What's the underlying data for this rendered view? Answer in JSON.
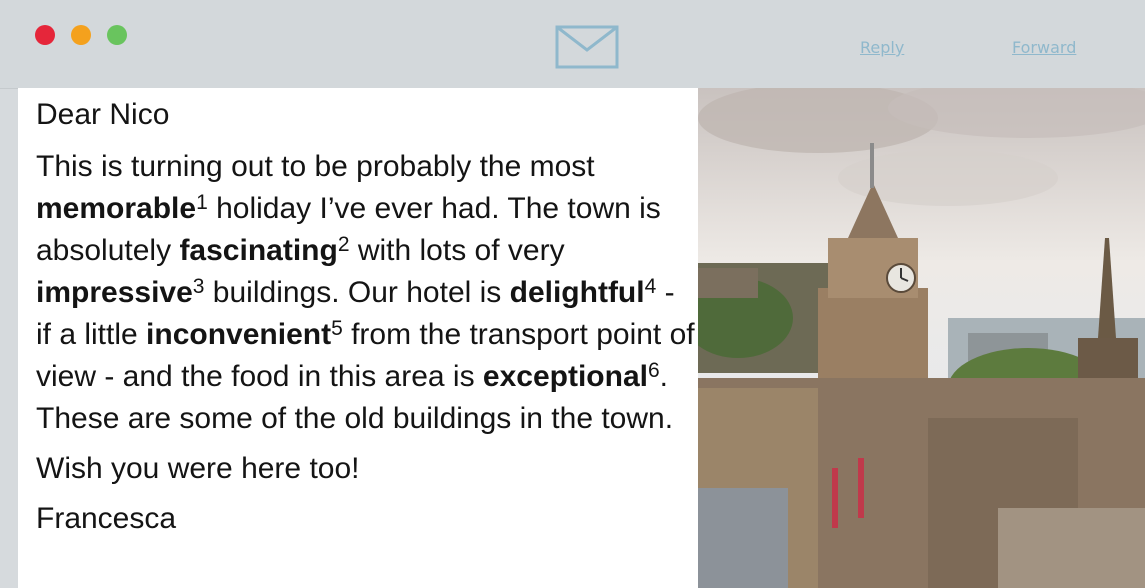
{
  "toolbar": {
    "window_controls": [
      "close",
      "minimize",
      "zoom"
    ],
    "mail_icon": "envelope-icon",
    "reply_label": "Reply",
    "forward_label": "Forward"
  },
  "email": {
    "greeting": "Dear Nico",
    "body": [
      {
        "t": "This is turning out to be probably the most "
      },
      {
        "t": "memorable",
        "b": true
      },
      {
        "t": "1",
        "sup": true
      },
      {
        "t": " holiday I’ve ever had. The town is absolutely "
      },
      {
        "t": "fascinating",
        "b": true
      },
      {
        "t": "2",
        "sup": true
      },
      {
        "t": " with lots of very "
      },
      {
        "t": "impressive",
        "b": true
      },
      {
        "t": "3",
        "sup": true
      },
      {
        "t": " buildings. Our hotel is "
      },
      {
        "t": "delightful",
        "b": true
      },
      {
        "t": "4",
        "sup": true
      },
      {
        "t": " - if a little "
      },
      {
        "t": "inconvenient",
        "b": true
      },
      {
        "t": "5",
        "sup": true
      },
      {
        "t": " from the transport point of view - and the food in this area is "
      },
      {
        "t": "exceptional",
        "b": true
      },
      {
        "t": "6",
        "sup": true
      },
      {
        "t": ". These are some of the old buildings in the town."
      }
    ],
    "closing": "Wish you were here too!",
    "signature": "Francesca"
  },
  "colors": {
    "toolbar": "#d3d8db",
    "close": "#e5263a",
    "minimize": "#f4a11d",
    "zoom": "#69c45e",
    "link": "#8fb8cc"
  }
}
